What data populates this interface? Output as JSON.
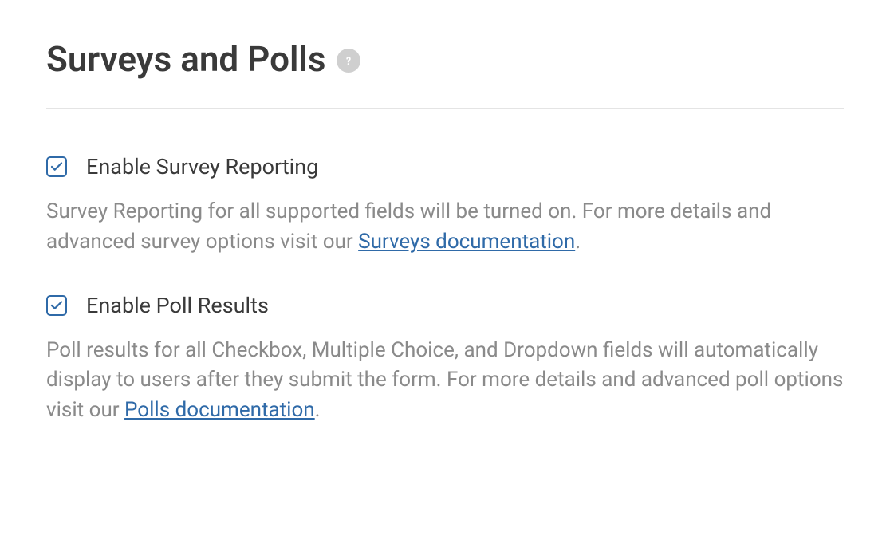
{
  "header": {
    "title": "Surveys and Polls"
  },
  "settings": {
    "survey": {
      "checked": true,
      "label": "Enable Survey Reporting",
      "description_pre": "Survey Reporting for all supported fields will be turned on. For more details and advanced survey options visit our ",
      "link_text": "Surveys documentation",
      "description_post": "."
    },
    "poll": {
      "checked": true,
      "label": "Enable Poll Results",
      "description_pre": "Poll results for all Checkbox, Multiple Choice, and Dropdown fields will automatically display to users after they submit the form. For more details and advanced poll options visit our ",
      "link_text": "Polls documentation",
      "description_post": "."
    }
  }
}
